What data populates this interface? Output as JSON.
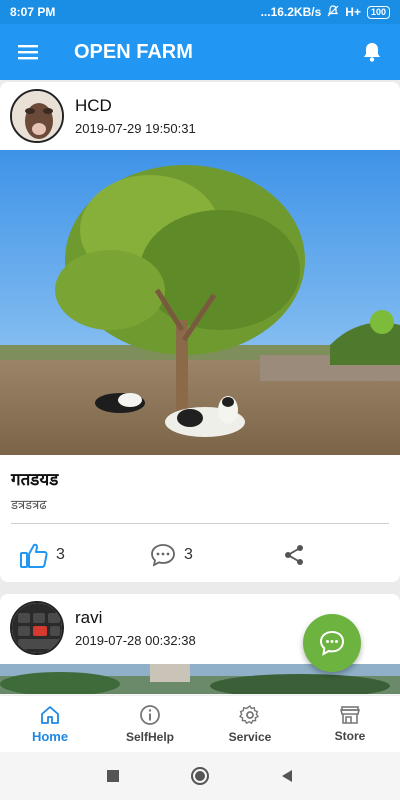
{
  "status_bar": {
    "time": "8:07 PM",
    "network": "...16.2KB/s",
    "signal": "H+",
    "battery": "100"
  },
  "app_bar": {
    "title": "OPEN FARM"
  },
  "posts": [
    {
      "author": "HCD",
      "timestamp": "2019-07-29 19:50:31",
      "title": "गतडयड",
      "subtitle": "डत्रडत्रढ",
      "likes": "3",
      "comments": "3"
    },
    {
      "author": "ravi",
      "timestamp": "2019-07-28 00:32:38"
    }
  ],
  "bottom_nav": [
    {
      "label": "Home",
      "icon": "home-icon",
      "active": true
    },
    {
      "label": "SelfHelp",
      "icon": "info-icon"
    },
    {
      "label": "Service",
      "icon": "gear-icon"
    },
    {
      "label": "Store",
      "icon": "store-icon"
    }
  ],
  "colors": {
    "status_bar": "#1a8ee5",
    "app_bar": "#2196f3",
    "fab": "#6cb33f",
    "active_nav": "#1e88e5"
  }
}
